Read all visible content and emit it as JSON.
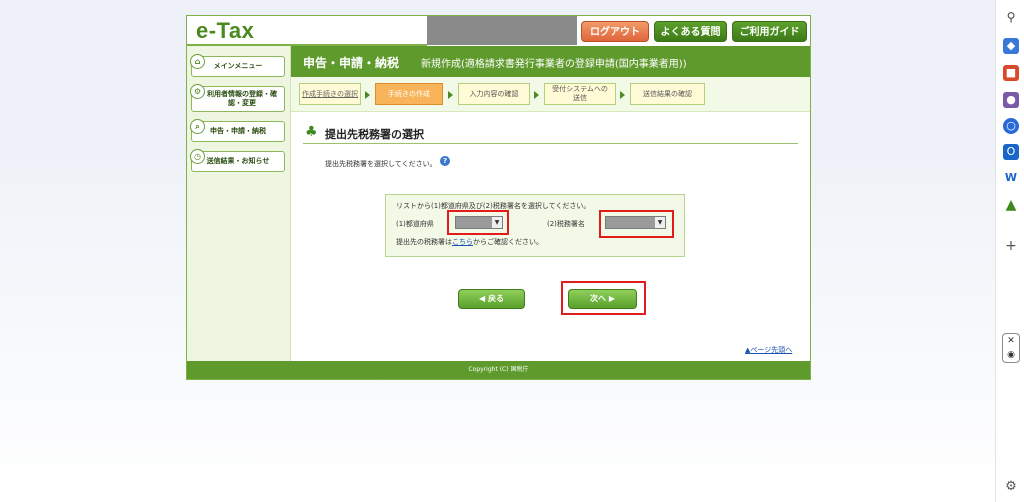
{
  "header": {
    "logo": "e-Tax",
    "logout": "ログアウト",
    "faq": "よくある質問",
    "guide": "ご利用ガイド"
  },
  "leftnav": {
    "items": [
      {
        "label": "メインメニュー"
      },
      {
        "label": "利用者情報の登録・確認・変更"
      },
      {
        "label": "申告・申請・納税"
      },
      {
        "label": "送信結果・お知らせ"
      }
    ]
  },
  "titlebar": {
    "main": "申告・申請・納税",
    "sub": "新規作成(適格請求書発行事業者の登録申請(国内事業者用))"
  },
  "steps": [
    {
      "label": "作成手続きの選択"
    },
    {
      "label": "手続きの作成"
    },
    {
      "label": "入力内容の確認"
    },
    {
      "label": "受付システムへの送信"
    },
    {
      "label": "送信結果の確認"
    }
  ],
  "section": {
    "title": "提出先税務署の選択",
    "instruction": "提出先税務署を選択してください。"
  },
  "selector": {
    "intro": "リストから(1)都道府県及び(2)税務署名を選択してください。",
    "pref_label": "(1)都道府県",
    "office_label": "(2)税務署名",
    "note_pre": "提出先の税務署は",
    "note_link": "こちら",
    "note_post": "からご確認ください。"
  },
  "buttons": {
    "back": "戻る",
    "next": "次へ"
  },
  "pagetop": "ページ先頭へ",
  "footer": "Copyright (C) 国税庁",
  "colors": {
    "brand_green": "#5f9a2c",
    "highlight_red": "#e21b1b",
    "active_step": "#f7b45a"
  }
}
